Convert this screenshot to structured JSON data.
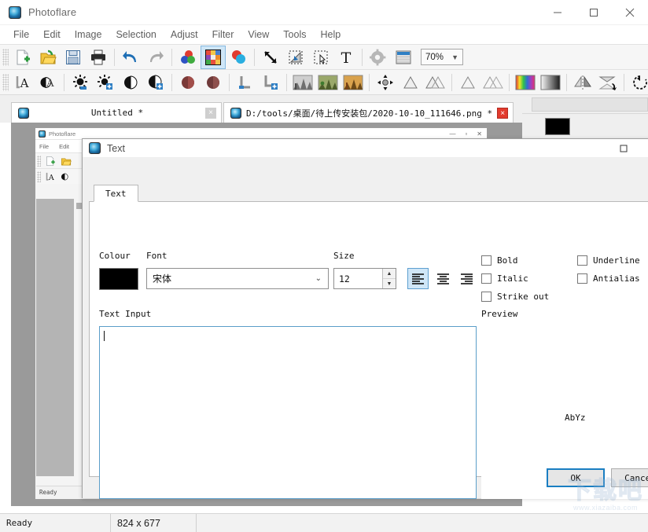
{
  "window": {
    "title": "Photoflare",
    "app_icon": "photoflare-icon",
    "controls": {
      "minimize": "minimize-icon",
      "maximize": "maximize-icon",
      "close": "close-icon"
    }
  },
  "menubar": {
    "items": [
      {
        "label": "File"
      },
      {
        "label": "Edit"
      },
      {
        "label": "Image"
      },
      {
        "label": "Selection"
      },
      {
        "label": "Adjust"
      },
      {
        "label": "Filter"
      },
      {
        "label": "View"
      },
      {
        "label": "Tools"
      },
      {
        "label": "Help"
      }
    ]
  },
  "toolbar_top": {
    "zoom_value": "70%",
    "buttons": [
      {
        "name": "new-file-icon"
      },
      {
        "name": "open-folder-icon"
      },
      {
        "name": "save-icon"
      },
      {
        "name": "print-icon"
      },
      {
        "name": "undo-icon"
      },
      {
        "name": "redo-icon"
      },
      {
        "name": "colour-picker-icon"
      },
      {
        "name": "palette-icon"
      },
      {
        "name": "colour-balance-icon"
      },
      {
        "name": "move-tool-icon"
      },
      {
        "name": "free-transform-icon"
      },
      {
        "name": "rectangle-select-icon"
      },
      {
        "name": "text-tool-icon"
      },
      {
        "name": "settings-gear-icon"
      },
      {
        "name": "layers-icon"
      }
    ]
  },
  "toolbar_bottom": {
    "buttons": [
      {
        "name": "text-left-icon"
      },
      {
        "name": "text-fill-icon"
      },
      {
        "name": "brightness-icon"
      },
      {
        "name": "brightness-plus-icon"
      },
      {
        "name": "contrast-icon"
      },
      {
        "name": "contrast-plus-icon"
      },
      {
        "name": "saturation-icon"
      },
      {
        "name": "saturation-alt-icon"
      },
      {
        "name": "levels-icon"
      },
      {
        "name": "levels-plus-icon"
      },
      {
        "name": "histogram-grey-icon"
      },
      {
        "name": "histogram-green-icon"
      },
      {
        "name": "histogram-orange-icon"
      },
      {
        "name": "scatter-icon"
      },
      {
        "name": "blur-icon"
      },
      {
        "name": "blur-more-icon"
      },
      {
        "name": "sharpen-icon"
      },
      {
        "name": "sharpen-more-icon"
      },
      {
        "name": "rainbow-gradient-icon"
      },
      {
        "name": "grey-gradient-icon"
      },
      {
        "name": "flip-horizontal-icon"
      },
      {
        "name": "flip-vertical-icon"
      },
      {
        "name": "rotate-left-icon"
      },
      {
        "name": "rotate-right-icon"
      }
    ]
  },
  "tabs": [
    {
      "label": "Untitled *",
      "icon": "photoflare-icon",
      "close": "×",
      "active": false
    },
    {
      "label": "D:/tools/桌面/待上传安装包/2020-10-10_111646.png *",
      "icon": "photoflare-icon",
      "close": "×",
      "active": true
    }
  ],
  "background_window": {
    "title": "Photoflare",
    "menu": [
      {
        "label": "File"
      },
      {
        "label": "Edit"
      }
    ],
    "status": "Ready"
  },
  "dialog": {
    "title": "Text",
    "icon": "photoflare-icon",
    "controls": {
      "maximize": "maximize-icon",
      "close": "close-icon"
    },
    "tab_label": "Text",
    "labels": {
      "colour": "Colour",
      "font": "Font",
      "size": "Size",
      "text_input": "Text Input",
      "preview": "Preview"
    },
    "colour_value": "#000000",
    "font_value": "宋体",
    "size_value": "12",
    "alignment": {
      "selected": "left",
      "options": [
        {
          "name": "align-left-button",
          "value": "left"
        },
        {
          "name": "align-center-button",
          "value": "center"
        },
        {
          "name": "align-right-button",
          "value": "right"
        }
      ]
    },
    "checkboxes": [
      {
        "label": "Bold",
        "checked": false,
        "name": "bold-checkbox"
      },
      {
        "label": "Italic",
        "checked": false,
        "name": "italic-checkbox"
      },
      {
        "label": "Strike out",
        "checked": false,
        "name": "strikeout-checkbox"
      },
      {
        "label": "Underline",
        "checked": false,
        "name": "underline-checkbox"
      },
      {
        "label": "Antialias",
        "checked": false,
        "name": "antialias-checkbox"
      }
    ],
    "text_input_value": "",
    "preview_sample": "AbYz",
    "ok_label": "OK",
    "cancel_label": "Cancel"
  },
  "statusbar": {
    "message": "Ready",
    "dimensions": "824 x 677"
  },
  "watermark": {
    "main": "下载吧",
    "sub": "www.xiazaiba.com"
  }
}
